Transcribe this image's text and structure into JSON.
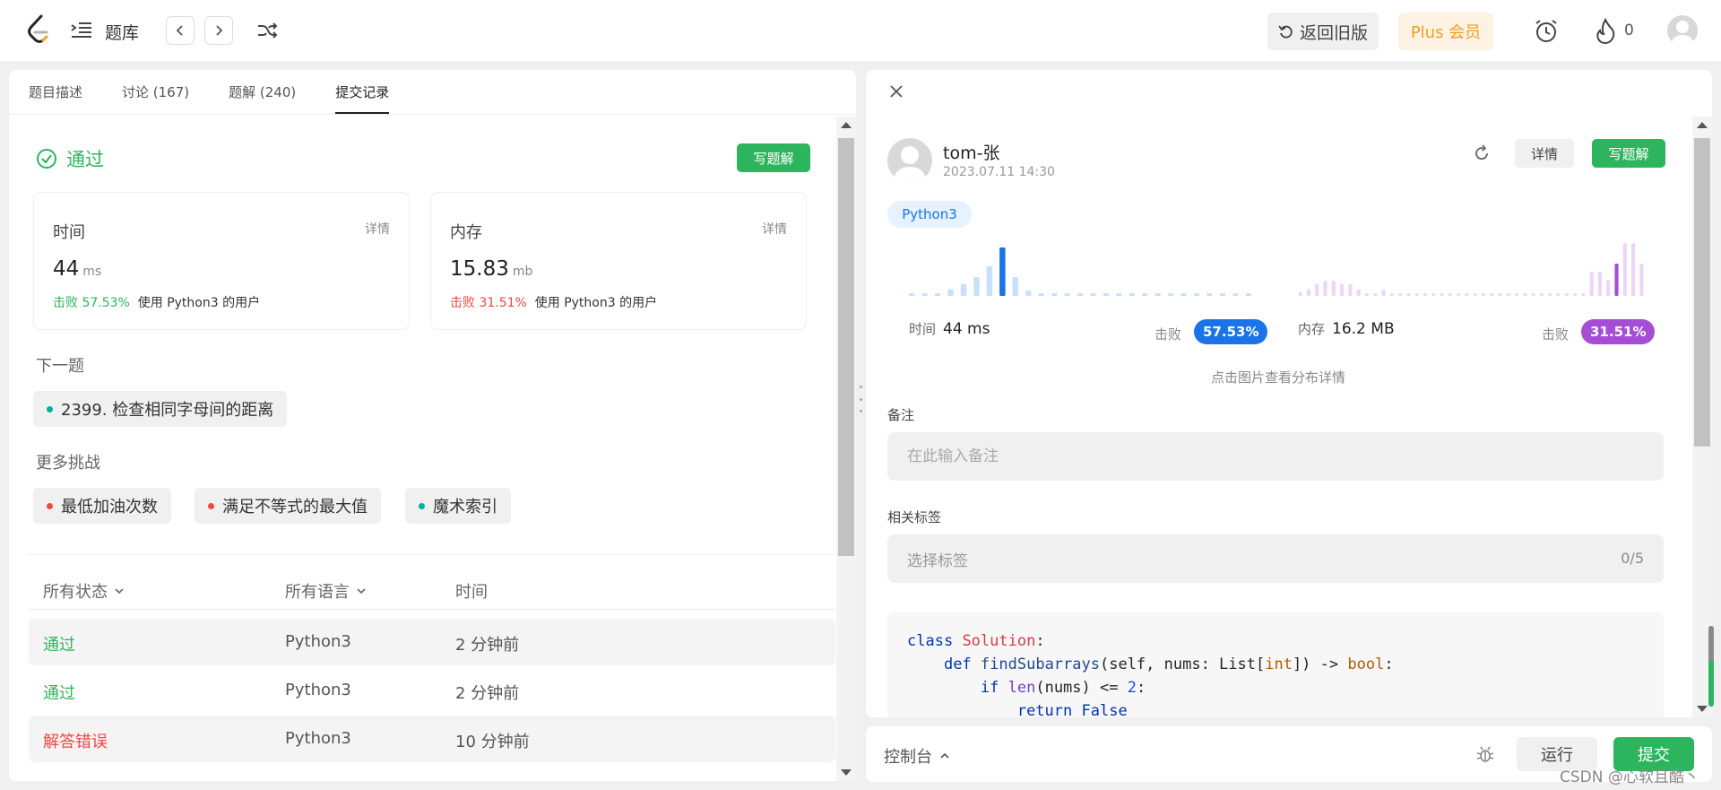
{
  "topnav": {
    "title": "题库",
    "old_version": "返回旧版",
    "plus": "Plus 会员",
    "fire_count": "0"
  },
  "left": {
    "tabs": [
      {
        "label": "题目描述"
      },
      {
        "label": "讨论 (167)"
      },
      {
        "label": "题解 (240)"
      },
      {
        "label": "提交记录"
      }
    ],
    "status": "通过",
    "write_solution": "写题解",
    "time_card": {
      "label": "时间",
      "detail": "详情",
      "value": "44",
      "unit": "ms",
      "beat_prefix": "击败",
      "beat_pct": "57.53%",
      "beat_suffix": "使用 Python3 的用户"
    },
    "memory_card": {
      "label": "内存",
      "detail": "详情",
      "value": "15.83",
      "unit": "mb",
      "beat_prefix": "击败",
      "beat_pct": "31.51%",
      "beat_suffix": "使用 Python3 的用户"
    },
    "next_label": "下一题",
    "next_problem": "2399. 检查相同字母间的距离",
    "more_label": "更多挑战",
    "challenges": [
      {
        "label": "最低加油次数",
        "color": "#ef4743"
      },
      {
        "label": "满足不等式的最大值",
        "color": "#ef4743"
      },
      {
        "label": "魔术索引",
        "color": "#00af9b"
      }
    ],
    "table": {
      "headers": [
        "所有状态",
        "所有语言",
        "时间"
      ],
      "rows": [
        {
          "status": "通过",
          "lang": "Python3",
          "time": "2 分钟前"
        },
        {
          "status": "通过",
          "lang": "Python3",
          "time": "2 分钟前"
        },
        {
          "status": "解答错误",
          "lang": "Python3",
          "time": "10 分钟前"
        }
      ]
    }
  },
  "right": {
    "user": "tom-张",
    "date": "2023.07.11 14:30",
    "detail_btn": "详情",
    "write_btn": "写题解",
    "lang": "Python3",
    "time_label": "时间",
    "time_value": "44 ms",
    "time_beat_label": "击败",
    "time_beat": "57.53%",
    "mem_label": "内存",
    "mem_value": "16.2 MB",
    "mem_beat_label": "击败",
    "mem_beat": "31.51%",
    "hint": "点击图片查看分布详情",
    "note_label": "备注",
    "note_placeholder": "在此输入备注",
    "tag_label": "相关标签",
    "tag_placeholder": "选择标签",
    "tag_count": "0/5",
    "code": {
      "line1_kw": "class",
      "line1_name": "Solution",
      "line2_kw": "def",
      "line2_fn": "findSubarrays",
      "line2_args": "(self, nums: List[",
      "line2_int": "int",
      "line2_end": "]) -> ",
      "line2_bool": "bool",
      "line3_kw": "if",
      "line3_len": "len",
      "line3_mid": "(nums) <= ",
      "line3_num": "2",
      "line4_kw": "return",
      "line4_val": "False"
    }
  },
  "console": {
    "label": "控制台",
    "run": "运行",
    "submit": "提交"
  },
  "watermark": "CSDN @心软且酷丶",
  "histograms": {
    "time_bars": [
      0.05,
      0.05,
      0.05,
      0.12,
      0.22,
      0.35,
      0.55,
      0.9,
      0.35,
      0.1,
      0.05,
      0.05,
      0.05,
      0.05,
      0.05,
      0.05,
      0.05,
      0.05,
      0.05,
      0.05,
      0.05,
      0.05,
      0.05,
      0.05,
      0.05,
      0.05,
      0.05
    ],
    "time_active": 7,
    "mem_bars": [
      0.08,
      0.12,
      0.22,
      0.28,
      0.28,
      0.22,
      0.22,
      0.12,
      0.05,
      0.05,
      0.12,
      0.05,
      0.05,
      0.05,
      0.05,
      0.05,
      0.05,
      0.05,
      0.05,
      0.05,
      0.05,
      0.05,
      0.05,
      0.05,
      0.05,
      0.05,
      0.05,
      0.05,
      0.05,
      0.05,
      0.05,
      0.05,
      0.05,
      0.05,
      0.05,
      0.45,
      0.45,
      0.3,
      0.6,
      0.98,
      0.98,
      0.6
    ],
    "mem_active": 38,
    "time_color": "#1a73e8",
    "time_faint": "#c7e0fb",
    "mem_color": "#a64dd6",
    "mem_faint": "#ecd6f7"
  }
}
